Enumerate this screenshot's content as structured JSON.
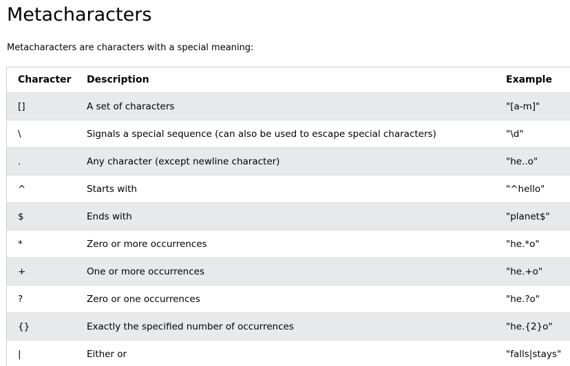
{
  "page": {
    "title": "Metacharacters",
    "intro": "Metacharacters are characters with a special meaning:"
  },
  "table": {
    "headers": {
      "character": "Character",
      "description": "Description",
      "example": "Example"
    },
    "rows": [
      {
        "character": "[]",
        "description": "A set of characters",
        "example": "\"[a-m]\""
      },
      {
        "character": "\\",
        "description": "Signals a special sequence (can also be used to escape special characters)",
        "example": "\"\\d\""
      },
      {
        "character": ".",
        "description": "Any character (except newline character)",
        "example": "\"he..o\""
      },
      {
        "character": "^",
        "description": "Starts with",
        "example": "\"^hello\""
      },
      {
        "character": "$",
        "description": "Ends with",
        "example": "\"planet$\""
      },
      {
        "character": "*",
        "description": "Zero or more occurrences",
        "example": "\"he.*o\""
      },
      {
        "character": "+",
        "description": "One or more occurrences",
        "example": "\"he.+o\""
      },
      {
        "character": "?",
        "description": "Zero or one occurrences",
        "example": "\"he.?o\""
      },
      {
        "character": "{}",
        "description": "Exactly the specified number of occurrences",
        "example": "\"he.{2}o\""
      },
      {
        "character": "|",
        "description": "Either or",
        "example": "\"falls|stays\""
      }
    ]
  }
}
